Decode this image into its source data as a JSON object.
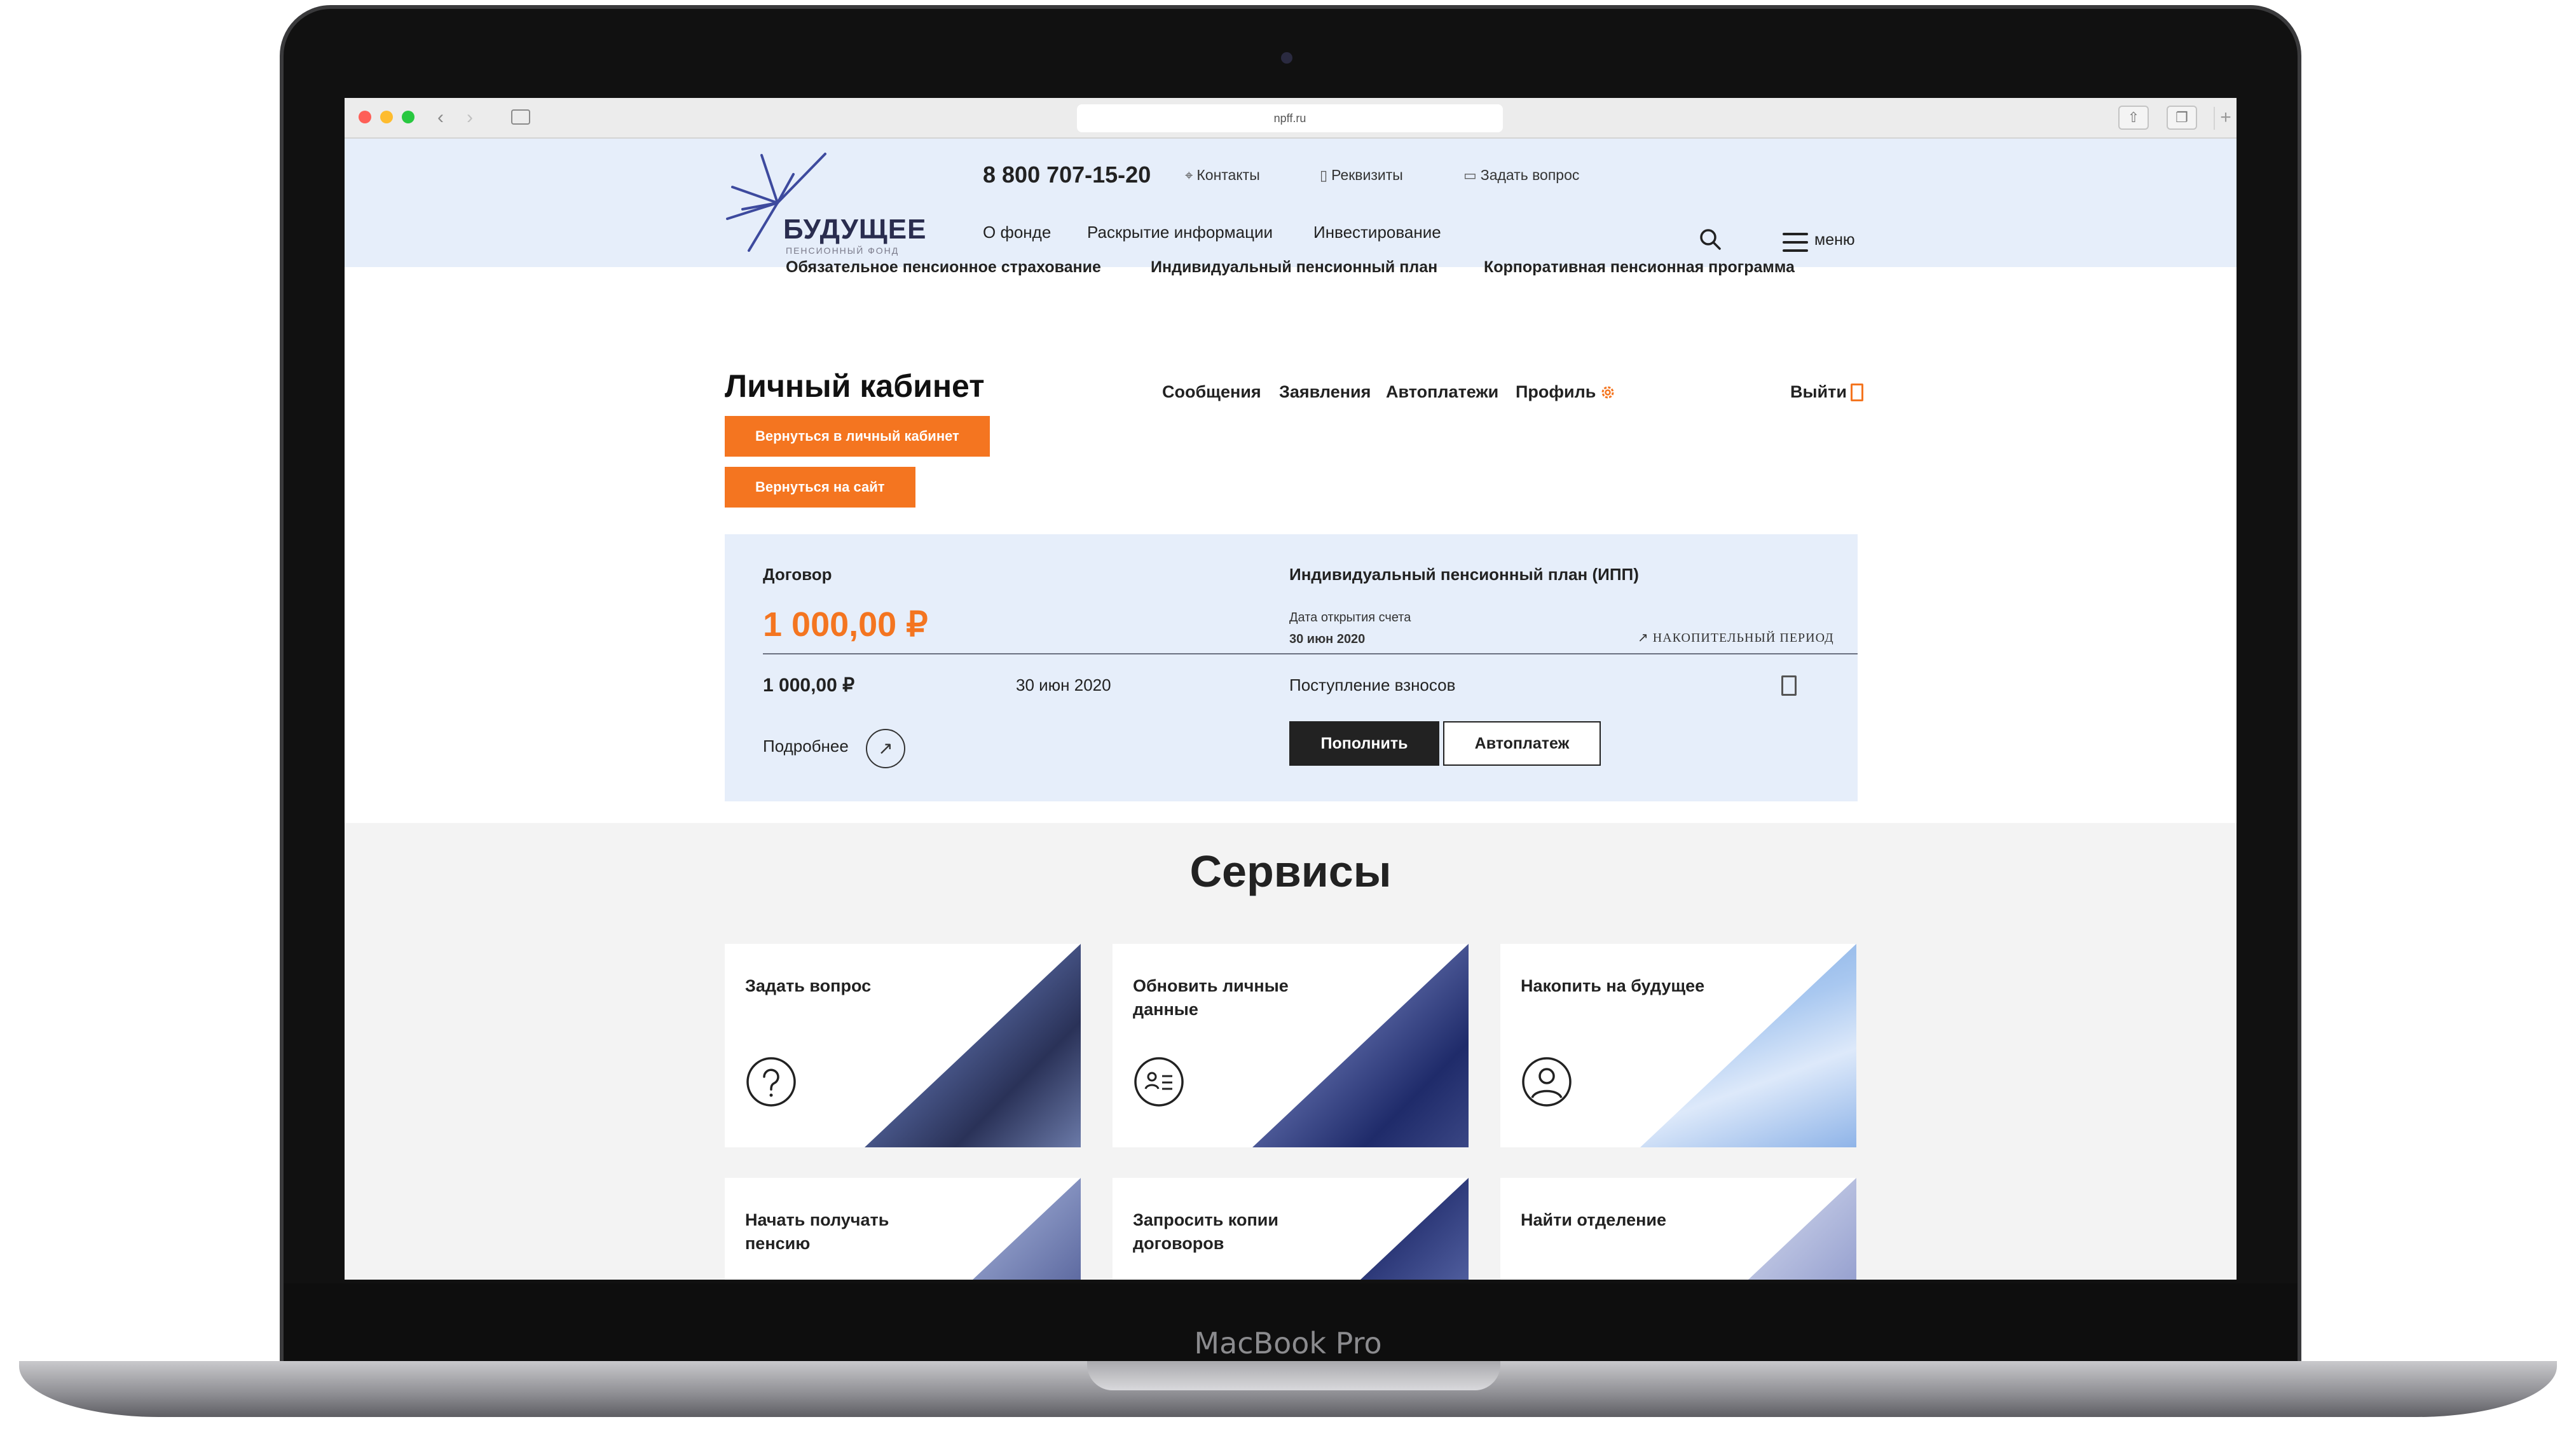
{
  "browser": {
    "url": "npff.ru"
  },
  "device": {
    "brand": "MacBook Pro"
  },
  "header": {
    "logo_text": "БУДУЩЕЕ",
    "logo_sub": "ПЕНСИОННЫЙ ФОНД",
    "phone": "8 800 707-15-20",
    "top_links": [
      "Контакты",
      "Реквизиты",
      "Задать вопрос"
    ],
    "nav": [
      "О фонде",
      "Раскрытие информации",
      "Инвестирование"
    ],
    "menu_label": "меню"
  },
  "subnav": [
    "Обязательное пенсионное страхование",
    "Индивидуальный пенсионный план",
    "Корпоративная пенсионная программа"
  ],
  "cabinet": {
    "title": "Личный кабинет",
    "nav": [
      "Сообщения",
      "Заявления",
      "Автоплатежи",
      "Профиль"
    ],
    "exit": "Выйти",
    "btn_back_cabinet": "Вернуться в личный кабинет",
    "btn_back_site": "Вернуться на сайт"
  },
  "contract": {
    "label": "Договор",
    "amount": "1 000,00 ₽",
    "plan_name": "Индивидуальный пенсионный план (ИПП)",
    "open_date_label": "Дата открытия счета",
    "open_date": "30 июн 2020",
    "period": "НАКОПИТЕЛЬНЫЙ ПЕРИОД",
    "last_amount": "1 000,00 ₽",
    "last_date": "30 июн 2020",
    "contributions_label": "Поступление взносов",
    "more": "Подробнее",
    "btn_topup": "Пополнить",
    "btn_autopay": "Автоплатеж"
  },
  "services": {
    "title": "Сервисы",
    "tiles": [
      {
        "title": "Задать вопрос",
        "icon": "question-icon"
      },
      {
        "title": "Обновить личные данные",
        "icon": "id-card-icon"
      },
      {
        "title": "Накопить на будущее",
        "icon": "user-icon"
      },
      {
        "title": "Начать получать пенсию",
        "icon": ""
      },
      {
        "title": "Запросить копии договоров",
        "icon": ""
      },
      {
        "title": "Найти отделение",
        "icon": ""
      }
    ]
  },
  "colors": {
    "accent": "#f47520",
    "header_bg": "#e6eefa",
    "dark": "#222222"
  }
}
